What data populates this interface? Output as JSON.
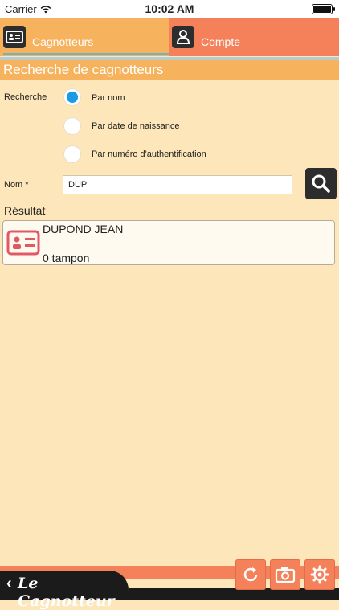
{
  "status_bar": {
    "carrier": "Carrier",
    "time": "10:02 AM"
  },
  "tabs": [
    {
      "label": "Cagnotteurs",
      "icon": "id-card-icon"
    },
    {
      "label": "Compte",
      "icon": "user-icon"
    }
  ],
  "section_title": "Recherche de cagnotteurs",
  "search": {
    "label": "Recherche",
    "options": [
      {
        "label": "Par nom",
        "checked": true
      },
      {
        "label": "Par date de naissance",
        "checked": false
      },
      {
        "label": "Par numéro d'authentification",
        "checked": false
      }
    ]
  },
  "name_field": {
    "label": "Nom *",
    "value": "DUP"
  },
  "result": {
    "title": "Résultat",
    "items": [
      {
        "name": "DUPOND JEAN",
        "stamps": "0 tampon"
      }
    ]
  },
  "bottom": {
    "brand": "Le Cagnotteur",
    "buttons": [
      "refresh-icon",
      "camera-icon",
      "settings-icon"
    ]
  },
  "colors": {
    "background": "#fde6b9",
    "tab_cagnotteurs": "#f6b25c",
    "tab_compte": "#f4815a",
    "accent_blue": "#1a9be3",
    "card_icon": "#e05a66"
  }
}
